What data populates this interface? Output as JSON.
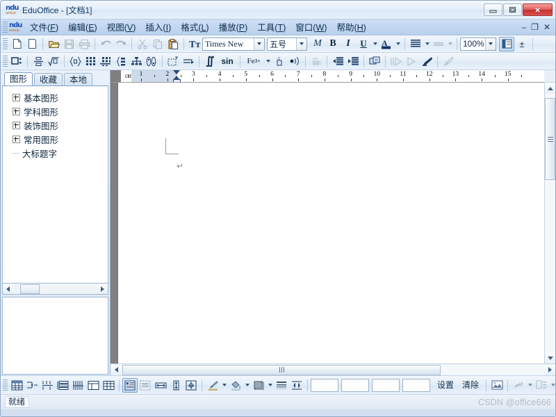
{
  "window": {
    "title": "EduOffice - [文档1]",
    "logo_top": "ndu",
    "logo_bottom": "OFFICE",
    "buttons": {
      "minimize": "minimize-button",
      "maximize": "maximize-button",
      "close": "×"
    },
    "mdi_buttons": {
      "minimize": "–",
      "restore": "❐",
      "close": "✕"
    }
  },
  "menu": {
    "items": [
      {
        "label": "文件",
        "accel": "F"
      },
      {
        "label": "编辑",
        "accel": "E"
      },
      {
        "label": "视图",
        "accel": "V"
      },
      {
        "label": "插入",
        "accel": "I"
      },
      {
        "label": "格式",
        "accel": "L"
      },
      {
        "label": "播放",
        "accel": "P"
      },
      {
        "label": "工具",
        "accel": "T"
      },
      {
        "label": "窗口",
        "accel": "W"
      },
      {
        "label": "帮助",
        "accel": "H"
      }
    ]
  },
  "toolbar_standard": {
    "buttons": [
      "new-document-icon",
      "new-blank-icon",
      "open-folder-icon",
      "save-icon",
      "print-icon",
      "undo-icon",
      "redo-icon",
      "cut-scissors-icon",
      "copy-icon",
      "paste-icon"
    ],
    "font_icon": "font-format-icon",
    "font_name": "Times New ",
    "font_size": "五号",
    "style_buttons": [
      "math-italic-icon",
      "bold-icon",
      "italic-icon",
      "underline-icon"
    ],
    "bold_label": "B",
    "italic_label": "I",
    "underline_label": "U",
    "math_label": "M",
    "font_color_icon": "font-color-icon",
    "align_icon": "align-justify-icon",
    "line_spacing_icon": "line-spacing-icon",
    "zoom_value": "100%",
    "page_layout_icon": "page-layout-icon",
    "plusminus_label": "±"
  },
  "toolbar_formula": {
    "buttons": [
      "template-box-icon",
      "fraction-icon",
      "radical-icon",
      "braces-icon",
      "matrix-icon",
      "matrix-plus-icon",
      "cases-icon",
      "tree-diagram-icon",
      "binomial-icon",
      "dashed-box-icon",
      "arrow-over-icon",
      "integral-icon",
      "sin-function-icon",
      "subsuperscript-icon",
      "limit-icon",
      "chem-bond-icon",
      "audio-icon",
      "grid-pin-icon",
      "indent-decrease-icon",
      "indent-increase-icon",
      "object-stack-icon",
      "play-step-icon",
      "play-icon",
      "highlight-pen-icon",
      "pencil-icon"
    ],
    "sin_label": "sin",
    "fe_label": "Fe",
    "fe_sup": "3+"
  },
  "sidebar": {
    "tabs": [
      {
        "label": "图形",
        "selected": true
      },
      {
        "label": "收藏",
        "selected": false
      },
      {
        "label": "本地",
        "selected": false
      }
    ],
    "tree": [
      {
        "label": "基本图形",
        "type": "node"
      },
      {
        "label": "学科图形",
        "type": "node"
      },
      {
        "label": "装饰图形",
        "type": "node"
      },
      {
        "label": "常用图形",
        "type": "node"
      },
      {
        "label": "大标题字",
        "type": "leaf"
      }
    ]
  },
  "ruler": {
    "unit": "cm",
    "ticks": [
      "1",
      "2",
      "3",
      "4",
      "5",
      "6",
      "7",
      "8",
      "9",
      "10",
      "11",
      "12",
      "13",
      "14",
      "15"
    ]
  },
  "document": {
    "paragraph_mark": "↵"
  },
  "bottom_toolbar": {
    "buttons": [
      "insert-table-icon",
      "split-cells-icon",
      "merge-cells-icon",
      "table-rows-icon",
      "table-columns-icon",
      "table-properties-icon",
      "table-grid-icon",
      "text-box-icon",
      "shaded-box-icon",
      "distribute-horizontal-icon",
      "distribute-vertical-icon",
      "align-center-icon",
      "line-color-icon",
      "fill-color-icon",
      "shape-fill-icon",
      "line-style-icon",
      "resize-icon",
      "picture-icon",
      "link-icon",
      "group-icon",
      "shadow-icon",
      "rotate-icon"
    ],
    "settings_label": "设置",
    "clear_label": "清除",
    "swatch_count": 4
  },
  "statusbar": {
    "message": "就绪",
    "watermark": "CSDN @office666"
  },
  "colors": {
    "accent": "#2b4a70",
    "menu_bg": "#c3d7f0",
    "close_red": "#c62f2f",
    "page_bg": "#ffffff",
    "canvas_gray": "#808080"
  }
}
